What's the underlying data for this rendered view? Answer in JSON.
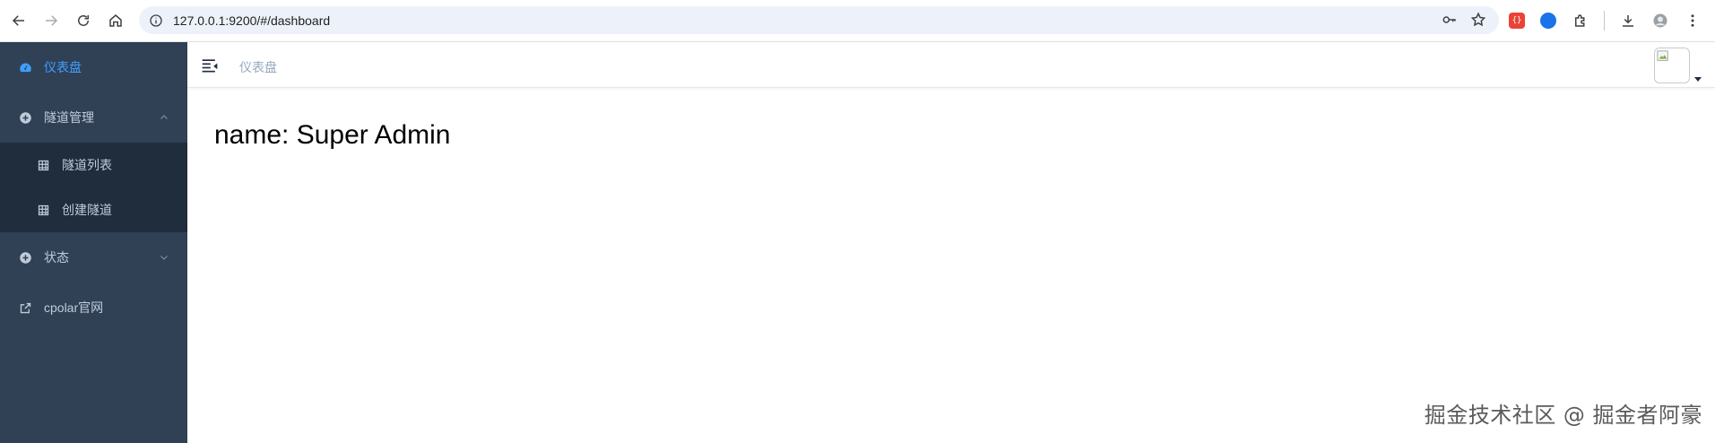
{
  "browser": {
    "url": "127.0.0.1:9200/#/dashboard"
  },
  "sidebar": {
    "items": [
      {
        "label": "仪表盘",
        "icon": "dashboard-icon",
        "active": true
      },
      {
        "label": "隧道管理",
        "icon": "plus-circle-icon",
        "expanded": true,
        "children": [
          {
            "label": "隧道列表",
            "icon": "table-icon"
          },
          {
            "label": "创建隧道",
            "icon": "table-icon"
          }
        ]
      },
      {
        "label": "状态",
        "icon": "plus-circle-icon",
        "expanded": false
      },
      {
        "label": "cpolar官网",
        "icon": "external-link-icon"
      }
    ]
  },
  "navbar": {
    "breadcrumb": "仪表盘"
  },
  "main": {
    "name_text": "name: Super Admin"
  },
  "watermark": "掘金技术社区 @ 掘金者阿豪",
  "colors": {
    "sidebar_bg": "#304156",
    "submenu_bg": "#1f2d3d",
    "menu_text": "#bfcbd9",
    "active_text": "#409eff"
  }
}
